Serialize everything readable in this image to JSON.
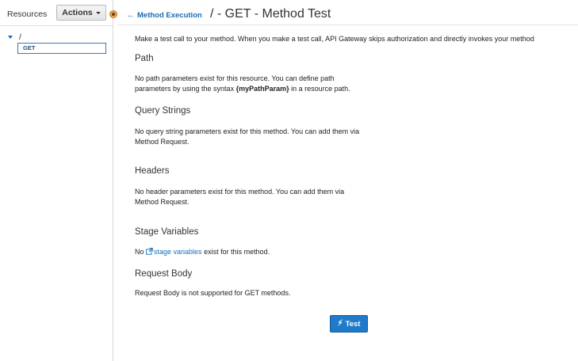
{
  "sidebar": {
    "resources_label": "Resources",
    "actions_label": "Actions",
    "tree": {
      "root_label": "/",
      "method_label": "GET"
    }
  },
  "header": {
    "back_label": "Method Execution",
    "title": "/ - GET - Method Test"
  },
  "main": {
    "intro": "Make a test call to your method. When you make a test call, API Gateway skips authorization and directly invokes your method",
    "path": {
      "title": "Path",
      "line1": "No path parameters exist for this resource. You can define path",
      "line2_prefix": "parameters by using the syntax ",
      "line2_code": "{myPathParam}",
      "line2_suffix": " in a resource path."
    },
    "query": {
      "title": "Query Strings",
      "line1": "No query string parameters exist for this method. You can add them via",
      "line2": "Method Request."
    },
    "headers": {
      "title": "Headers",
      "line1": "No header parameters exist for this method. You can add them via",
      "line2": "Method Request."
    },
    "stage": {
      "title": "Stage Variables",
      "prefix": "No ",
      "link": "stage variables",
      "suffix": " exist for this method."
    },
    "body": {
      "title": "Request Body",
      "text": "Request Body is not supported for GET methods."
    },
    "test_button": "Test"
  },
  "colors": {
    "accent": "#1a6cb7",
    "button": "#1f7bc9",
    "splitter": "#f0a650"
  }
}
